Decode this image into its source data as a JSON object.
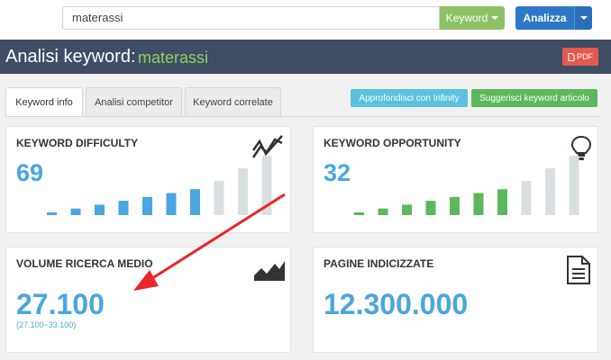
{
  "search": {
    "value": "materassi",
    "mode_label": "Keyword",
    "submit_label": "Analizza"
  },
  "header": {
    "title": "Analisi keyword:",
    "keyword": "materassi",
    "pdf_label": "PDF"
  },
  "tabs": [
    {
      "label": "Keyword info",
      "active": true
    },
    {
      "label": "Analisi competitor",
      "active": false
    },
    {
      "label": "Keyword correlate",
      "active": false
    }
  ],
  "actions": {
    "infinity_label": "Approfondisci con Infinity",
    "suggest_label": "Suggerisci keyword articolo"
  },
  "cards": {
    "difficulty": {
      "title": "KEYWORD DIFFICULTY",
      "value": "69",
      "icon": "trend-lines-icon",
      "level_bars": 7,
      "total_bars": 10,
      "active_color": "#4aa6e0",
      "inactive_color": "#d9dfe1"
    },
    "opportunity": {
      "title": "KEYWORD OPPORTUNITY",
      "value": "32",
      "icon": "lightbulb-icon",
      "level_bars": 7,
      "total_bars": 10,
      "active_color": "#5cb85c",
      "inactive_color": "#d9dfe1"
    },
    "volume": {
      "title": "VOLUME RICERCA MEDIO",
      "value": "27.100",
      "range": "(27.100~33.100)",
      "icon": "area-chart-icon"
    },
    "pages": {
      "title": "PAGINE INDICIZZATE",
      "value": "12.300.000",
      "icon": "document-icon"
    }
  },
  "colors": {
    "accent_blue": "#4aa6e0",
    "header_bg": "#3f4d65",
    "keyword_green": "#8fcf5f",
    "annotation_red": "#e8262b"
  }
}
